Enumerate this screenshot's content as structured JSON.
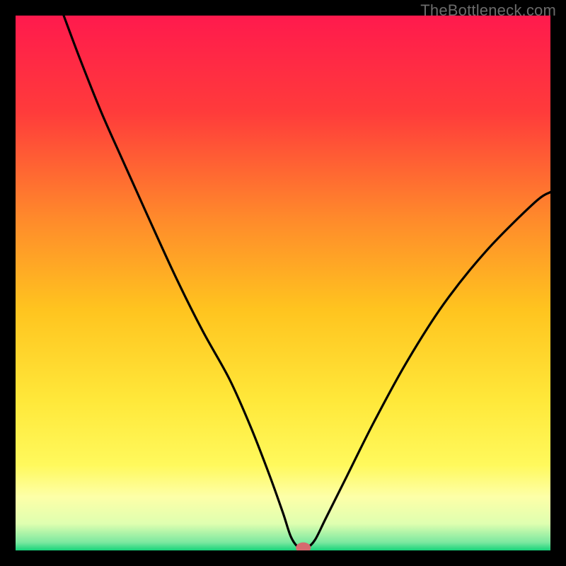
{
  "watermark": "TheBottleneck.com",
  "chart_data": {
    "type": "line",
    "title": "",
    "xlabel": "",
    "ylabel": "",
    "xlim": [
      0,
      100
    ],
    "ylim": [
      0,
      100
    ],
    "grid": false,
    "legend": false,
    "background_gradient": [
      {
        "offset": 0.0,
        "color": "#ff1a4d"
      },
      {
        "offset": 0.18,
        "color": "#ff3b3b"
      },
      {
        "offset": 0.38,
        "color": "#ff8a2b"
      },
      {
        "offset": 0.55,
        "color": "#ffc41f"
      },
      {
        "offset": 0.72,
        "color": "#ffe83a"
      },
      {
        "offset": 0.84,
        "color": "#fff95c"
      },
      {
        "offset": 0.9,
        "color": "#fdffa8"
      },
      {
        "offset": 0.95,
        "color": "#dfffb0"
      },
      {
        "offset": 0.985,
        "color": "#7be8a0"
      },
      {
        "offset": 1.0,
        "color": "#17d37a"
      }
    ],
    "series": [
      {
        "name": "bottleneck-curve",
        "x": [
          9.0,
          12.0,
          16.0,
          20.0,
          24.5,
          30.0,
          35.0,
          40.0,
          44.0,
          47.5,
          50.0,
          51.5,
          53.0,
          54.5,
          56.0,
          58.0,
          62.0,
          67.0,
          73.0,
          80.0,
          88.0,
          97.0,
          100.0
        ],
        "y": [
          100.0,
          92.0,
          82.0,
          73.0,
          63.0,
          51.0,
          41.0,
          32.0,
          23.0,
          14.0,
          7.0,
          2.5,
          0.5,
          0.5,
          2.0,
          6.0,
          14.0,
          24.0,
          35.0,
          46.0,
          56.0,
          65.0,
          67.0
        ]
      }
    ],
    "marker": {
      "name": "bottleneck-point",
      "x": 53.8,
      "y": 0.5,
      "rx": 1.4,
      "ry": 1.0,
      "color": "#d66a6f"
    }
  }
}
